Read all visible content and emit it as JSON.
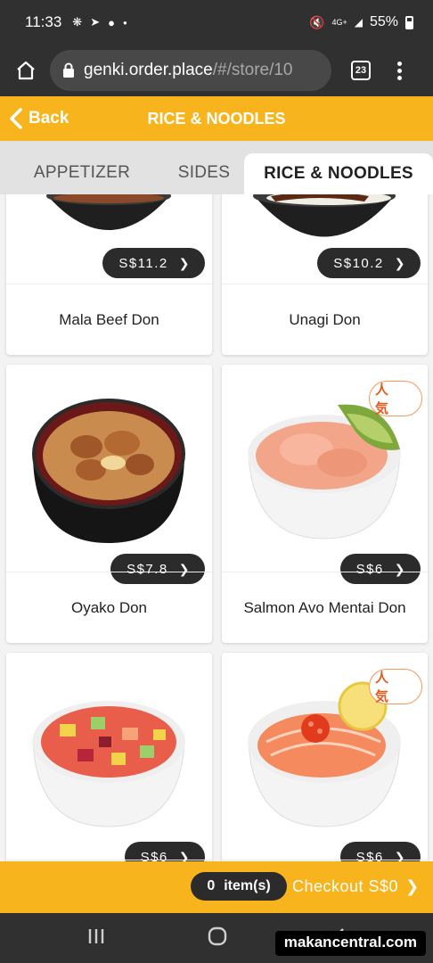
{
  "status_bar": {
    "time": "11:33",
    "battery": "55%",
    "network": "4G+"
  },
  "browser": {
    "url_host": "genki.order.place",
    "url_path": "/#/store/10",
    "tab_count": "23"
  },
  "header": {
    "back_label": "Back",
    "title": "RICE & NOODLES",
    "accent_color": "#f7b41c"
  },
  "categories": {
    "tabs": [
      {
        "label": "APPETIZER"
      },
      {
        "label": "SIDES"
      },
      {
        "label": "RICE & NOODLES"
      }
    ],
    "active": "RICE & NOODLES"
  },
  "menu": {
    "badge_label": "人 気",
    "items": [
      {
        "name": "Mala Beef Don",
        "price": "S$11.2"
      },
      {
        "name": "Unagi Don",
        "price": "S$10.2"
      },
      {
        "name": "Oyako Don",
        "price": "S$7.8"
      },
      {
        "name": "Salmon Avo Mentai Don",
        "price": "S$6",
        "popular": true
      },
      {
        "name": "",
        "price": "S$6"
      },
      {
        "name": "",
        "price": "S$6",
        "popular": true
      }
    ]
  },
  "checkout": {
    "item_count": "0",
    "items_label": "item(s)",
    "checkout_label": "Checkout S$0"
  },
  "watermark": "makancentral.com"
}
